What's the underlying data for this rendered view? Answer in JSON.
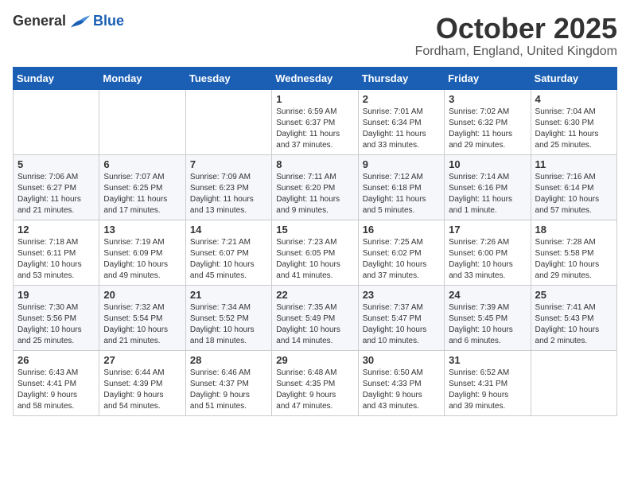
{
  "logo": {
    "general": "General",
    "blue": "Blue"
  },
  "title": "October 2025",
  "location": "Fordham, England, United Kingdom",
  "days_of_week": [
    "Sunday",
    "Monday",
    "Tuesday",
    "Wednesday",
    "Thursday",
    "Friday",
    "Saturday"
  ],
  "weeks": [
    [
      {
        "day": "",
        "info": ""
      },
      {
        "day": "",
        "info": ""
      },
      {
        "day": "",
        "info": ""
      },
      {
        "day": "1",
        "info": "Sunrise: 6:59 AM\nSunset: 6:37 PM\nDaylight: 11 hours\nand 37 minutes."
      },
      {
        "day": "2",
        "info": "Sunrise: 7:01 AM\nSunset: 6:34 PM\nDaylight: 11 hours\nand 33 minutes."
      },
      {
        "day": "3",
        "info": "Sunrise: 7:02 AM\nSunset: 6:32 PM\nDaylight: 11 hours\nand 29 minutes."
      },
      {
        "day": "4",
        "info": "Sunrise: 7:04 AM\nSunset: 6:30 PM\nDaylight: 11 hours\nand 25 minutes."
      }
    ],
    [
      {
        "day": "5",
        "info": "Sunrise: 7:06 AM\nSunset: 6:27 PM\nDaylight: 11 hours\nand 21 minutes."
      },
      {
        "day": "6",
        "info": "Sunrise: 7:07 AM\nSunset: 6:25 PM\nDaylight: 11 hours\nand 17 minutes."
      },
      {
        "day": "7",
        "info": "Sunrise: 7:09 AM\nSunset: 6:23 PM\nDaylight: 11 hours\nand 13 minutes."
      },
      {
        "day": "8",
        "info": "Sunrise: 7:11 AM\nSunset: 6:20 PM\nDaylight: 11 hours\nand 9 minutes."
      },
      {
        "day": "9",
        "info": "Sunrise: 7:12 AM\nSunset: 6:18 PM\nDaylight: 11 hours\nand 5 minutes."
      },
      {
        "day": "10",
        "info": "Sunrise: 7:14 AM\nSunset: 6:16 PM\nDaylight: 11 hours\nand 1 minute."
      },
      {
        "day": "11",
        "info": "Sunrise: 7:16 AM\nSunset: 6:14 PM\nDaylight: 10 hours\nand 57 minutes."
      }
    ],
    [
      {
        "day": "12",
        "info": "Sunrise: 7:18 AM\nSunset: 6:11 PM\nDaylight: 10 hours\nand 53 minutes."
      },
      {
        "day": "13",
        "info": "Sunrise: 7:19 AM\nSunset: 6:09 PM\nDaylight: 10 hours\nand 49 minutes."
      },
      {
        "day": "14",
        "info": "Sunrise: 7:21 AM\nSunset: 6:07 PM\nDaylight: 10 hours\nand 45 minutes."
      },
      {
        "day": "15",
        "info": "Sunrise: 7:23 AM\nSunset: 6:05 PM\nDaylight: 10 hours\nand 41 minutes."
      },
      {
        "day": "16",
        "info": "Sunrise: 7:25 AM\nSunset: 6:02 PM\nDaylight: 10 hours\nand 37 minutes."
      },
      {
        "day": "17",
        "info": "Sunrise: 7:26 AM\nSunset: 6:00 PM\nDaylight: 10 hours\nand 33 minutes."
      },
      {
        "day": "18",
        "info": "Sunrise: 7:28 AM\nSunset: 5:58 PM\nDaylight: 10 hours\nand 29 minutes."
      }
    ],
    [
      {
        "day": "19",
        "info": "Sunrise: 7:30 AM\nSunset: 5:56 PM\nDaylight: 10 hours\nand 25 minutes."
      },
      {
        "day": "20",
        "info": "Sunrise: 7:32 AM\nSunset: 5:54 PM\nDaylight: 10 hours\nand 21 minutes."
      },
      {
        "day": "21",
        "info": "Sunrise: 7:34 AM\nSunset: 5:52 PM\nDaylight: 10 hours\nand 18 minutes."
      },
      {
        "day": "22",
        "info": "Sunrise: 7:35 AM\nSunset: 5:49 PM\nDaylight: 10 hours\nand 14 minutes."
      },
      {
        "day": "23",
        "info": "Sunrise: 7:37 AM\nSunset: 5:47 PM\nDaylight: 10 hours\nand 10 minutes."
      },
      {
        "day": "24",
        "info": "Sunrise: 7:39 AM\nSunset: 5:45 PM\nDaylight: 10 hours\nand 6 minutes."
      },
      {
        "day": "25",
        "info": "Sunrise: 7:41 AM\nSunset: 5:43 PM\nDaylight: 10 hours\nand 2 minutes."
      }
    ],
    [
      {
        "day": "26",
        "info": "Sunrise: 6:43 AM\nSunset: 4:41 PM\nDaylight: 9 hours\nand 58 minutes."
      },
      {
        "day": "27",
        "info": "Sunrise: 6:44 AM\nSunset: 4:39 PM\nDaylight: 9 hours\nand 54 minutes."
      },
      {
        "day": "28",
        "info": "Sunrise: 6:46 AM\nSunset: 4:37 PM\nDaylight: 9 hours\nand 51 minutes."
      },
      {
        "day": "29",
        "info": "Sunrise: 6:48 AM\nSunset: 4:35 PM\nDaylight: 9 hours\nand 47 minutes."
      },
      {
        "day": "30",
        "info": "Sunrise: 6:50 AM\nSunset: 4:33 PM\nDaylight: 9 hours\nand 43 minutes."
      },
      {
        "day": "31",
        "info": "Sunrise: 6:52 AM\nSunset: 4:31 PM\nDaylight: 9 hours\nand 39 minutes."
      },
      {
        "day": "",
        "info": ""
      }
    ]
  ]
}
